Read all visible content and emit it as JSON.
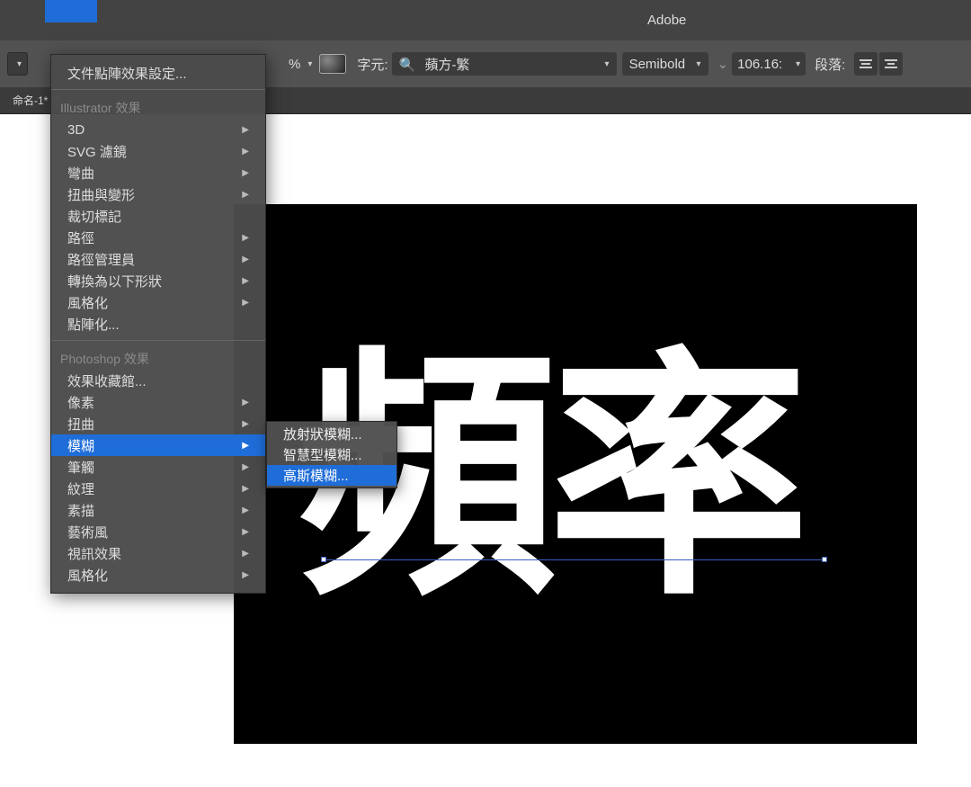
{
  "title_bar": {
    "app_name": "Adobe"
  },
  "control_bar": {
    "pct_label": "%",
    "char_label": "字元:",
    "font_name": "蘋方-繁",
    "font_weight": "Semibold",
    "font_size": "106.16:",
    "para_label": "段落:"
  },
  "doc_tab": {
    "name": "命名-1* @"
  },
  "artboard": {
    "text": "頻率"
  },
  "menu": {
    "top_item": "文件點陣效果設定...",
    "section_illustrator": "Illustrator 效果",
    "illustrator_items": [
      {
        "label": "3D",
        "has_sub": true
      },
      {
        "label": "SVG 濾鏡",
        "has_sub": true
      },
      {
        "label": "彎曲",
        "has_sub": true
      },
      {
        "label": "扭曲與變形",
        "has_sub": true
      },
      {
        "label": "裁切標記",
        "has_sub": false
      },
      {
        "label": "路徑",
        "has_sub": true
      },
      {
        "label": "路徑管理員",
        "has_sub": true
      },
      {
        "label": "轉換為以下形狀",
        "has_sub": true
      },
      {
        "label": "風格化",
        "has_sub": true
      },
      {
        "label": "點陣化...",
        "has_sub": false
      }
    ],
    "section_photoshop": "Photoshop 效果",
    "photoshop_items": [
      {
        "label": "效果收藏館...",
        "has_sub": false
      },
      {
        "label": "像素",
        "has_sub": true
      },
      {
        "label": "扭曲",
        "has_sub": true
      },
      {
        "label": "模糊",
        "has_sub": true,
        "highlighted": true
      },
      {
        "label": "筆觸",
        "has_sub": true
      },
      {
        "label": "紋理",
        "has_sub": true
      },
      {
        "label": "素描",
        "has_sub": true
      },
      {
        "label": "藝術風",
        "has_sub": true
      },
      {
        "label": "視訊效果",
        "has_sub": true
      },
      {
        "label": "風格化",
        "has_sub": true
      }
    ]
  },
  "submenu": {
    "items": [
      {
        "label": "放射狀模糊..."
      },
      {
        "label": "智慧型模糊..."
      },
      {
        "label": "高斯模糊...",
        "highlighted": true
      }
    ]
  }
}
